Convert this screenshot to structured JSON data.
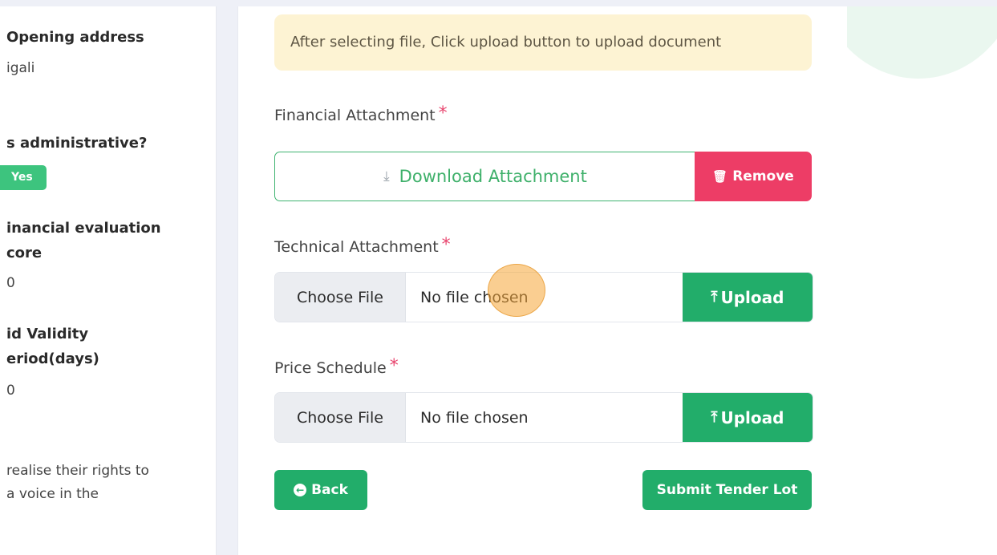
{
  "left_panel": {
    "opening_address_title": "Opening address",
    "opening_address_value": "igali",
    "administrative_title": "s administrative?",
    "administrative_badge": "Yes",
    "financial_eval_title_1": "inancial evaluation",
    "financial_eval_title_2": "core",
    "financial_eval_value": "0",
    "bid_validity_title_1": "id Validity",
    "bid_validity_title_2": "eriod(days)",
    "bid_validity_value": "0",
    "description_line_1": "realise their rights to",
    "description_line_2": "a voice in the"
  },
  "main": {
    "alert_text": "After selecting file, Click upload button to upload document",
    "financial": {
      "label": "Financial Attachment",
      "required": "*",
      "download_label": "Download Attachment",
      "remove_label": "Remove"
    },
    "technical": {
      "label": "Technical Attachment",
      "required": "*",
      "choose_label": "Choose File",
      "status": "No file chosen",
      "upload_label": "Upload"
    },
    "price_schedule": {
      "label": "Price Schedule",
      "required": "*",
      "choose_label": "Choose File",
      "status": "No file chosen",
      "upload_label": "Upload"
    },
    "back_label": "Back",
    "submit_label": "Submit Tender Lot"
  },
  "icons": {
    "download": "download-icon",
    "remove": "trash-icon",
    "upload": "upload-icon",
    "back": "arrow-circle-left-icon"
  },
  "colors": {
    "primary_green": "#22ad6a",
    "danger_red": "#ed3d66",
    "alert_bg": "#fdf3d3",
    "required_star": "#e8456e"
  }
}
